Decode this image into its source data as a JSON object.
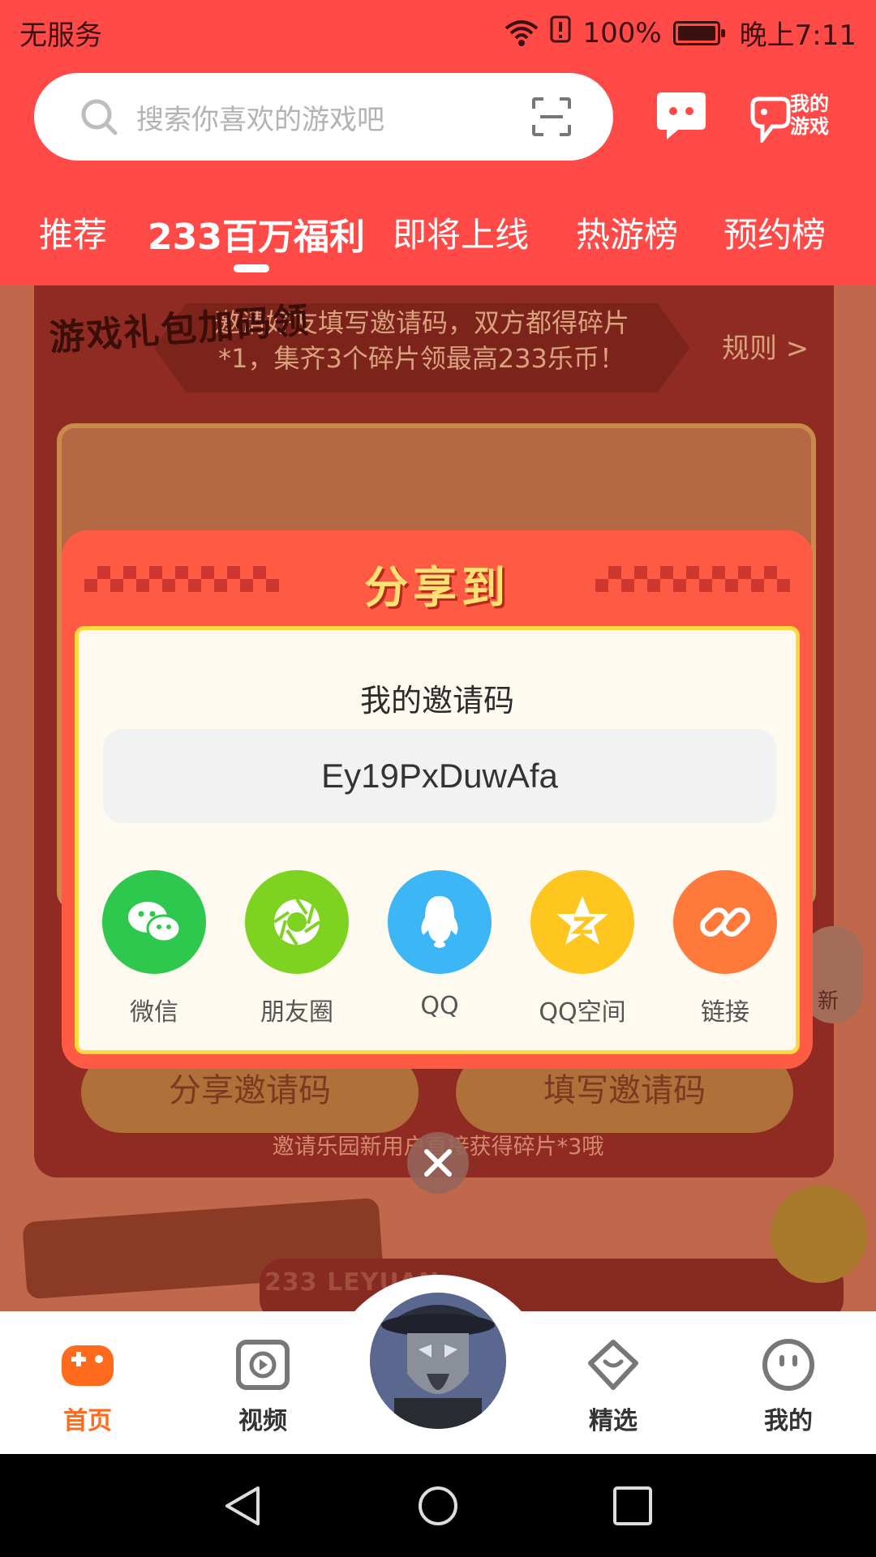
{
  "status_bar": {
    "carrier": "无服务",
    "battery": "100%",
    "time": "晚上7:11"
  },
  "search": {
    "placeholder": "搜索你喜欢的游戏吧"
  },
  "header": {
    "my_games_label": "我的游戏"
  },
  "tabs": [
    {
      "label": "推荐",
      "active": false
    },
    {
      "label": "233百万福利",
      "active": true
    },
    {
      "label": "即将上线",
      "active": false
    },
    {
      "label": "热游榜",
      "active": false
    },
    {
      "label": "预约榜",
      "active": false
    }
  ],
  "background": {
    "invite_text_line1": "邀请好友填写邀请码，双方都得碎片",
    "invite_text_line2": "*1，集齐3个碎片领最高233乐币！",
    "rules_link": "规则 >",
    "share_code_button": "分享邀请码",
    "fill_code_button": "填写邀请码",
    "hint": "邀请乐园新用户直接获得碎片*3哦",
    "refresh_label": "新",
    "gift_tag": "游戏礼包加码领",
    "leyuan_strip": "233 LEYUAN"
  },
  "modal": {
    "title": "分享到",
    "code_label": "我的邀请码",
    "code_value": "Ey19PxDuwAfa",
    "share_options": [
      {
        "label": "微信",
        "icon": "wechat-icon",
        "color": "#2dc84d"
      },
      {
        "label": "朋友圈",
        "icon": "moments-icon",
        "color": "#7ed321"
      },
      {
        "label": "QQ",
        "icon": "qq-icon",
        "color": "#3cb6f5"
      },
      {
        "label": "QQ空间",
        "icon": "qzone-icon",
        "color": "#ffc61f"
      },
      {
        "label": "链接",
        "icon": "link-icon",
        "color": "#ff7a3a"
      }
    ]
  },
  "bottom_nav": [
    {
      "label": "首页",
      "active": true
    },
    {
      "label": "视频",
      "active": false
    },
    {
      "label": "精选",
      "active": false
    },
    {
      "label": "我的",
      "active": false
    }
  ],
  "colors": {
    "header": "#ff4a48",
    "accent_orange": "#ff6a1c",
    "modal": "#ff5a44",
    "title_yellow": "#ffe173"
  }
}
